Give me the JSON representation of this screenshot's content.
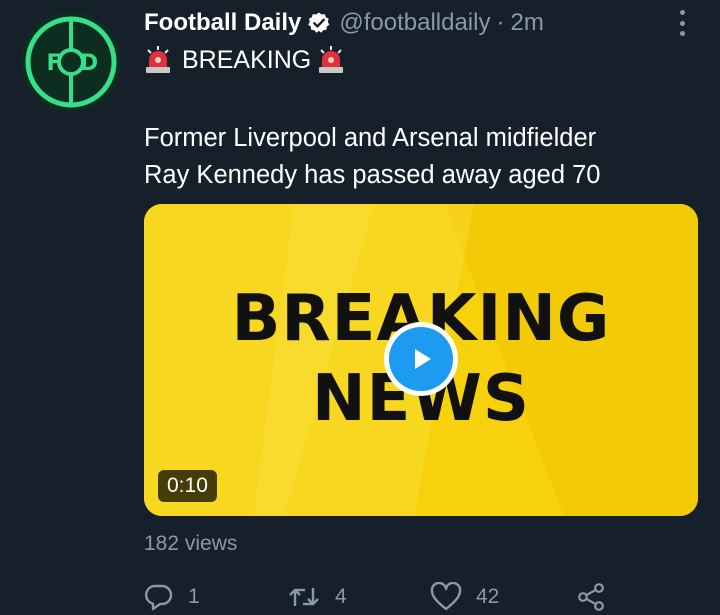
{
  "author": {
    "display_name": "Football Daily",
    "handle": "@footballdaily",
    "separator": "·",
    "time": "2m",
    "avatar_initials_left": "F",
    "avatar_initials_right": "D",
    "verified_icon": "verified-badge-icon"
  },
  "tweet": {
    "breaking_label": "BREAKING",
    "text_line1": "Former Liverpool and Arsenal midfielder",
    "text_line2": "Ray Kennedy has passed away aged 70"
  },
  "media": {
    "headline_line1": "BREAKING",
    "headline_line2": "NEWS",
    "duration": "0:10",
    "background_color": "#f5d20c"
  },
  "stats": {
    "views": "182 views"
  },
  "actions": {
    "reply_count": "1",
    "retweet_count": "4",
    "like_count": "42"
  },
  "colors": {
    "background": "#15202b",
    "muted": "#8b98a5",
    "accent": "#1d9bf0",
    "avatar_green": "#35e08a"
  }
}
